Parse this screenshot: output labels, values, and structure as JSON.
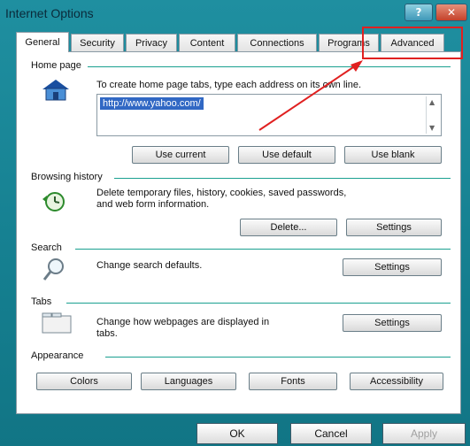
{
  "window": {
    "title": "Internet Options",
    "help_label": "?",
    "close_label": "✕"
  },
  "tabs": [
    "General",
    "Security",
    "Privacy",
    "Content",
    "Connections",
    "Programs",
    "Advanced"
  ],
  "home_page": {
    "group_label": "Home page",
    "description": "To create home page tabs, type each address on its own line.",
    "url": "http://www.yahoo.com/",
    "buttons": {
      "use_current": "Use current",
      "use_default": "Use default",
      "use_blank": "Use blank"
    }
  },
  "browsing_history": {
    "group_label": "Browsing history",
    "description_1": "Delete temporary files, history, cookies, saved passwords,",
    "description_2": "and web form information.",
    "buttons": {
      "delete": "Delete...",
      "settings": "Settings"
    }
  },
  "search": {
    "group_label": "Search",
    "description": "Change search defaults.",
    "settings": "Settings"
  },
  "tabs_group": {
    "group_label": "Tabs",
    "description_1": "Change how webpages are displayed in",
    "description_2": "tabs.",
    "settings": "Settings"
  },
  "appearance": {
    "group_label": "Appearance",
    "buttons": {
      "colors": "Colors",
      "languages": "Languages",
      "fonts": "Fonts",
      "accessibility": "Accessibility"
    }
  },
  "footer": {
    "ok": "OK",
    "cancel": "Cancel",
    "apply": "Apply"
  },
  "annotation": {
    "highlight_color": "#e02020"
  }
}
